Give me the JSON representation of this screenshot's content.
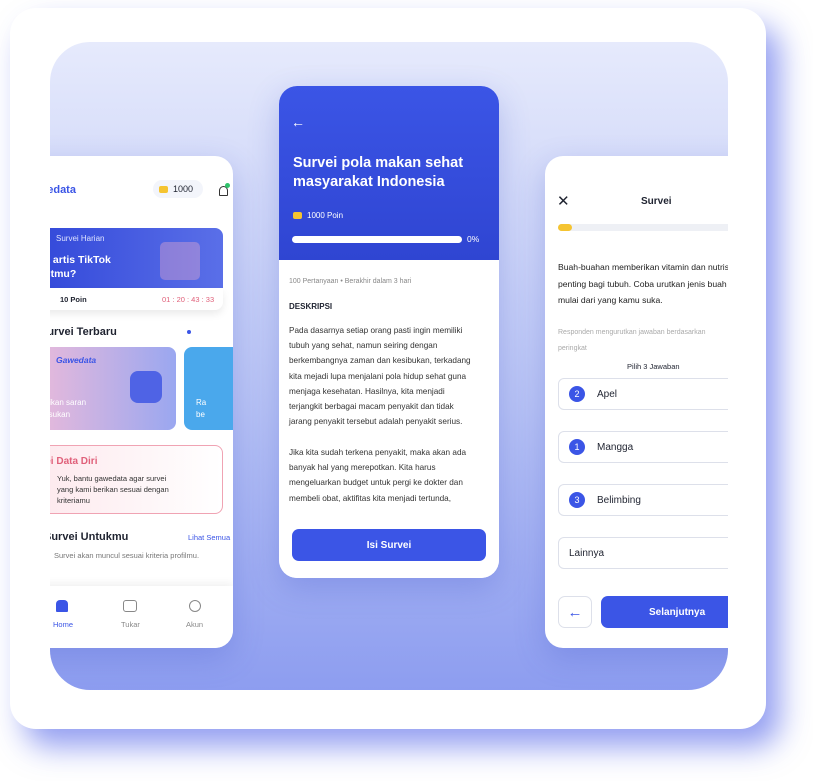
{
  "left_phone": {
    "logo": "Gawedata",
    "coins": "1000",
    "daily": {
      "tag": "Survei Harian",
      "title_l1": "Siapa artis TikTok",
      "title_l2": "favoritmu?",
      "points": "10 Poin",
      "timer": "01 : 20 : 43 : 33"
    },
    "latest_title": "Survei Terbaru",
    "promo": {
      "brand": "Gawedata",
      "text_l1": "Yuk berikan saran",
      "text_l2": "dan masukan"
    },
    "promo2": {
      "text_l1": "Ra",
      "text_l2": "be"
    },
    "data_diri": {
      "title": "Survei Data Diri",
      "l1": "Yuk, bantu gawedata agar survei",
      "l2": "yang kami berikan sesuai dengan",
      "l3": "kriteriamu"
    },
    "for_you": {
      "title": "Survei Untukmu",
      "see_all": "Lihat Semua",
      "sub": "Survei akan muncul sesuai kriteria profilmu."
    },
    "nav": [
      {
        "label": "Home"
      },
      {
        "label": "Tukar"
      },
      {
        "label": "Akun"
      }
    ]
  },
  "mid_phone": {
    "title_l1": "Survei pola makan sehat",
    "title_l2": "masyarakat Indonesia",
    "points": "1000 Poin",
    "progress_label": "0%",
    "progress": 0,
    "meta": "100 Pertanyaan • Berakhir dalam 3 hari",
    "desc_label": "DESKRIPSI",
    "p1": [
      "Pada dasarnya setiap orang pasti ingin memiliki",
      "tubuh yang sehat, namun seiring dengan",
      "berkembangnya zaman dan kesibukan, terkadang",
      "kita mejadi lupa menjalani pola hidup sehat guna",
      "menjaga kesehatan. Hasilnya, kita menjadi",
      "terjangkit berbagai macam penyakit dan tidak",
      "jarang penyakit tersebut adalah penyakit serius."
    ],
    "p2": [
      "Jika kita sudah terkena penyakit, maka akan ada",
      "banyak hal yang merepotkan. Kita harus",
      "mengeluarkan budget untuk pergi ke dokter dan",
      "membeli obat, aktifitas kita menjadi tertunda,"
    ],
    "cta": "Isi Survei"
  },
  "right_phone": {
    "title": "Survei",
    "question": [
      "Buah-buahan memberikan vitamin dan nutrisi",
      "penting bagi tubuh. Coba urutkan jenis buah",
      "mulai dari yang kamu suka."
    ],
    "hint_l1": "Responden mengurutkan jawaban berdasarkan",
    "hint_l2": "peringkat",
    "pick": "Pilih 3 Jawaban",
    "options": [
      {
        "rank": "2",
        "label": "Apel"
      },
      {
        "rank": "1",
        "label": "Mangga"
      },
      {
        "rank": "3",
        "label": "Belimbing"
      },
      {
        "rank": "",
        "label": "Lainnya"
      }
    ],
    "next": "Selanjutnya",
    "progress": 0.05
  },
  "colors": {
    "accent": "#3b55e6",
    "timer": "#e0607a"
  }
}
